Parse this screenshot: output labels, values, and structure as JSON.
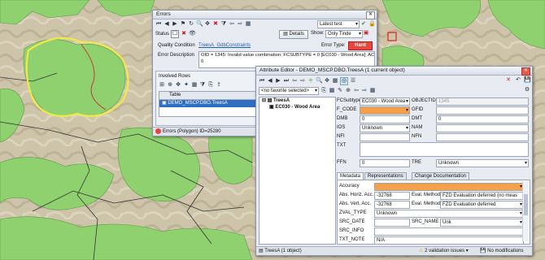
{
  "errors": {
    "title": "Errors",
    "dropdown_value": "Latest test",
    "status_label": "Status",
    "details_label": "Details",
    "show_label": "Show:",
    "show_value": "Only Tinde",
    "quality_label": "Quality Condition",
    "quality_value": "TreesA_GdbConstraints",
    "error_type_label": "Error Type:",
    "error_type_value": "Hard",
    "description_label": "Error Description",
    "description_value": "OID = 1345: Invalid value combination: FCSUBTYPE = 0 [EC030 - Wood Area]; ACC =",
    "description_line2": "0",
    "involved_rows_label": "Involved Rows",
    "table_header": "Table",
    "table_row": "DEMO_MSCP.DBO.TreesA",
    "status_text": "Errors (Polygon) ID=25280"
  },
  "attr": {
    "title": "Attribute Editor - DEMO_MSCP.DBO.TreesA (1 current object)",
    "favorite": "<no favorite selected>",
    "tree_root": "TreesA",
    "tree_child": "EC030 - Wood Area",
    "fields": {
      "fcsubtype_label": "FCSubtype",
      "fcsubtype_value": "EC030 - Wood Area",
      "objectid_label": "OBJECTID",
      "objectid_value": "1345",
      "fcode_label": "F_CODE",
      "fcode_value": "",
      "gfid_label": "GFID",
      "gfid_value": "",
      "dmb_label": "DMB",
      "dmb_value": "0",
      "dmt_label": "DMT",
      "dmt_value": "0",
      "ios_label": "IOS",
      "ios_value": "Unknown",
      "nam_label": "NAM",
      "nam_value": "",
      "nfi_label": "NFI",
      "nfi_value": "",
      "nfn_label": "NFN",
      "nfn_value": "",
      "txt_label": "TXT",
      "txt_value": "",
      "ffn_label": "FFN",
      "ffn_value": "0",
      "tre_label": "TRE",
      "tre_value": "Unknown"
    },
    "tabs": [
      "Metadata",
      "Representations",
      "Change Documentation"
    ],
    "meta": {
      "accuracy_label": "Accuracy",
      "accuracy_value": "",
      "abs_horiz_label": "Abs. Horiz. Acc.",
      "abs_horiz_value": "-32768",
      "eval_method_label": "Eval. Method",
      "eval1_value": "FZD Evaluation deferred (no meas",
      "abs_vert_label": "Abs. Vert. Acc.",
      "abs_vert_value": "-32768",
      "eval2_value": "FZD Evaluation deferred",
      "zval_label": "ZVAL_TYPE",
      "zval_value": "Unknown",
      "src_date_label": "SRC_DATE",
      "src_date_value": "",
      "src_name_label": "SRC_NAME",
      "src_name_value": "Unk",
      "src_info_label": "SRC_INFO",
      "src_info_value": "",
      "cut_label": "TXT_NOTE",
      "cut_value": "N/A"
    },
    "status_left": "TreesA (1 object)",
    "validation": "2 validation issues",
    "modifications": "No modifications"
  },
  "colors": {
    "map_bg": "#c9c1aa",
    "forest": "#8fd16f",
    "highlight": "#f1e84a",
    "error_red": "#e8463c"
  }
}
